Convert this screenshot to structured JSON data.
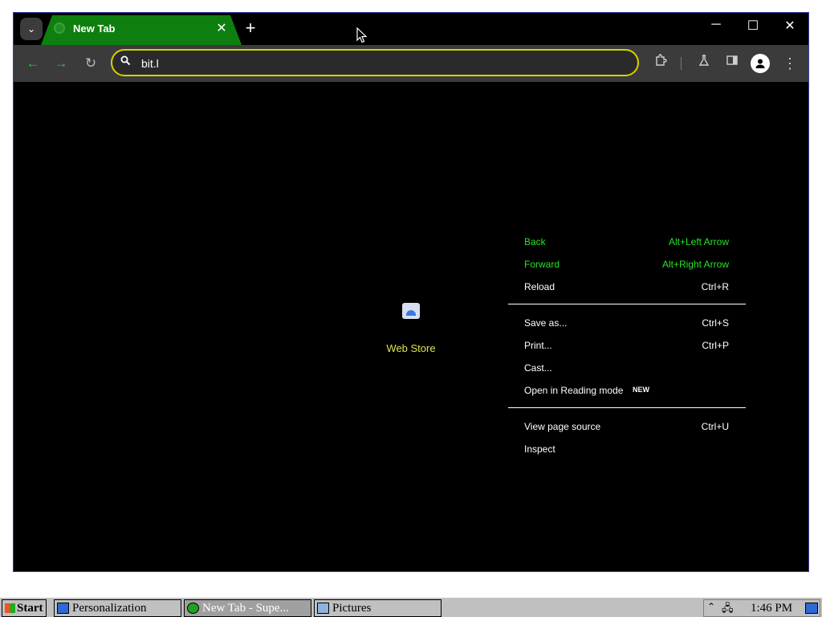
{
  "browser": {
    "tab": {
      "title": "New Tab",
      "close_glyph": "✕"
    },
    "new_tab_glyph": "+",
    "tab_search_glyph": "⌄",
    "window_controls": {
      "minimize": "─",
      "maximize": "☐",
      "close": "✕"
    },
    "toolbar": {
      "back_glyph": "←",
      "forward_glyph": "→",
      "reload_glyph": "↻",
      "omnibox_value": "bit.l",
      "search_glyph": "🔍",
      "menu_glyph": "⋮"
    },
    "content": {
      "shortcut_label": "Web Store"
    }
  },
  "context_menu": {
    "items": [
      {
        "label": "Back",
        "shortcut": "Alt+Left Arrow"
      },
      {
        "label": "Forward",
        "shortcut": "Alt+Right Arrow"
      },
      {
        "label": "Reload",
        "shortcut": "Ctrl+R"
      },
      {
        "label": "Save as...",
        "shortcut": "Ctrl+S"
      },
      {
        "label": "Print...",
        "shortcut": "Ctrl+P"
      },
      {
        "label": "Cast...",
        "shortcut": ""
      },
      {
        "label": "Open in Reading mode",
        "shortcut": "",
        "badge": "NEW"
      },
      {
        "label": "View page source",
        "shortcut": "Ctrl+U"
      },
      {
        "label": "Inspect",
        "shortcut": ""
      }
    ]
  },
  "taskbar": {
    "start_label": "Start",
    "tasks": [
      "Personalization",
      "New Tab - Supe...",
      "Pictures"
    ],
    "clock": "1:46 PM"
  },
  "colors": {
    "tab_active": "#0e7f0e",
    "omnibox_border": "#d8d000",
    "menu_highlight_text": "#27e327",
    "webstore_label": "#e6e14a"
  }
}
